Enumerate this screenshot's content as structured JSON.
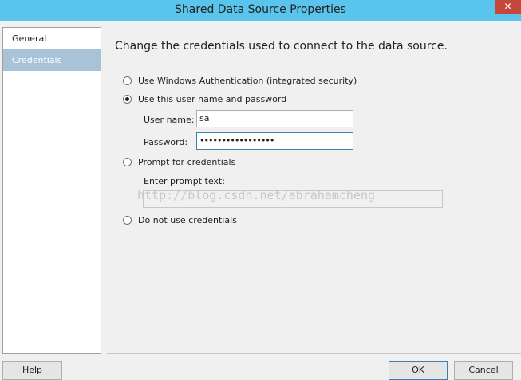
{
  "window": {
    "title": "Shared Data Source Properties",
    "close_glyph": "✕"
  },
  "sidebar": {
    "items": [
      {
        "label": "General",
        "selected": false
      },
      {
        "label": "Credentials",
        "selected": true
      }
    ]
  },
  "main": {
    "heading": "Change the credentials used to connect to the data source.",
    "options": {
      "windows_auth": "Use Windows Authentication (integrated security)",
      "user_password": "Use this user name and password",
      "prompt": "Prompt for credentials",
      "none": "Do not use credentials"
    },
    "selected_option": "user_password",
    "username_label": "User name:",
    "username_value": "sa",
    "password_label": "Password:",
    "password_value": "•••••••••••••••••",
    "prompt_label": "Enter prompt text:",
    "prompt_value": "",
    "watermark": "http://blog.csdn.net/abrahamcheng"
  },
  "footer": {
    "help": "Help",
    "ok": "OK",
    "cancel": "Cancel"
  }
}
